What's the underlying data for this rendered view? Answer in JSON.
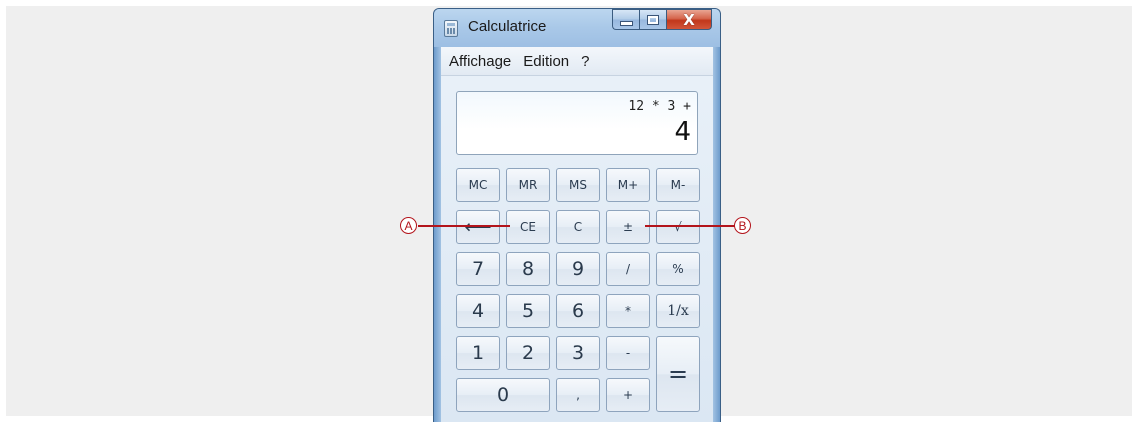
{
  "window": {
    "title": "Calculatrice",
    "close_glyph": "X"
  },
  "menu": [
    "Affichage",
    "Edition",
    "?"
  ],
  "display": {
    "expression": "12 * 3 +",
    "value": "4"
  },
  "keys": {
    "mc": "MC",
    "mr": "MR",
    "ms": "MS",
    "m_plus": "M+",
    "m_minus": "M-",
    "backspace": "⟵",
    "ce": "CE",
    "c": "C",
    "plus_minus": "±",
    "sqrt": "√",
    "seven": "7",
    "eight": "8",
    "nine": "9",
    "divide": "/",
    "percent": "%",
    "four": "4",
    "five": "5",
    "six": "6",
    "multiply": "*",
    "reciprocal": "1/x",
    "one": "1",
    "two": "2",
    "three": "3",
    "minus": "-",
    "equals": "=",
    "zero": "0",
    "decimal": ",",
    "plus": "+"
  },
  "callouts": {
    "a": "A",
    "b": "B"
  },
  "colors": {
    "callout": "#b3141b",
    "close_button": "#c1371b"
  }
}
